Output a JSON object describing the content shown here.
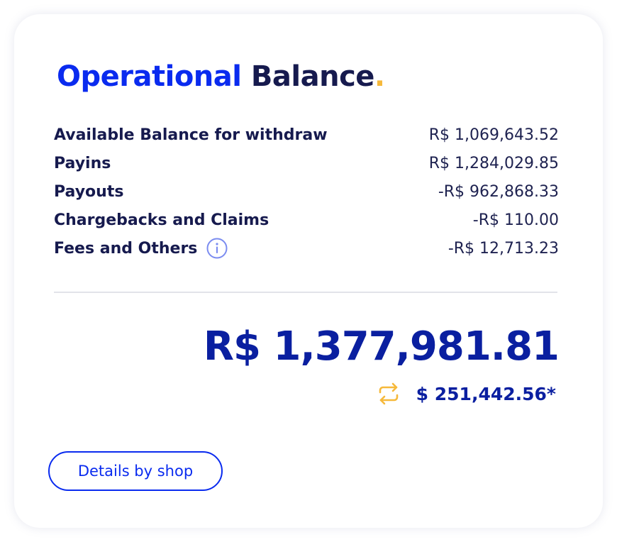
{
  "card": {
    "title_part1": "Operational",
    "title_part2": "Balance",
    "title_dot": ".",
    "rows": [
      {
        "label": "Available Balance for withdraw",
        "value": "R$ 1,069,643.52"
      },
      {
        "label": "Payins",
        "value": "R$ 1,284,029.85"
      },
      {
        "label": "Payouts",
        "value": "-R$ 962,868.33"
      },
      {
        "label": "Chargebacks and Claims",
        "value": "-R$ 110.00"
      },
      {
        "label": "Fees and Others",
        "value": "-R$ 12,713.23",
        "icon": "info-icon"
      }
    ],
    "total": "R$ 1,377,981.81",
    "converted": {
      "icon": "swap-arrows-icon",
      "value": "$ 251,442.56*"
    },
    "details_button_label": "Details by shop"
  },
  "colors": {
    "accent_blue": "#0a2bef",
    "dark_navy": "#161a4e",
    "total_blue": "#0a1fa0",
    "yellow": "#f6b93b",
    "info_icon": "#7b8cf0"
  }
}
